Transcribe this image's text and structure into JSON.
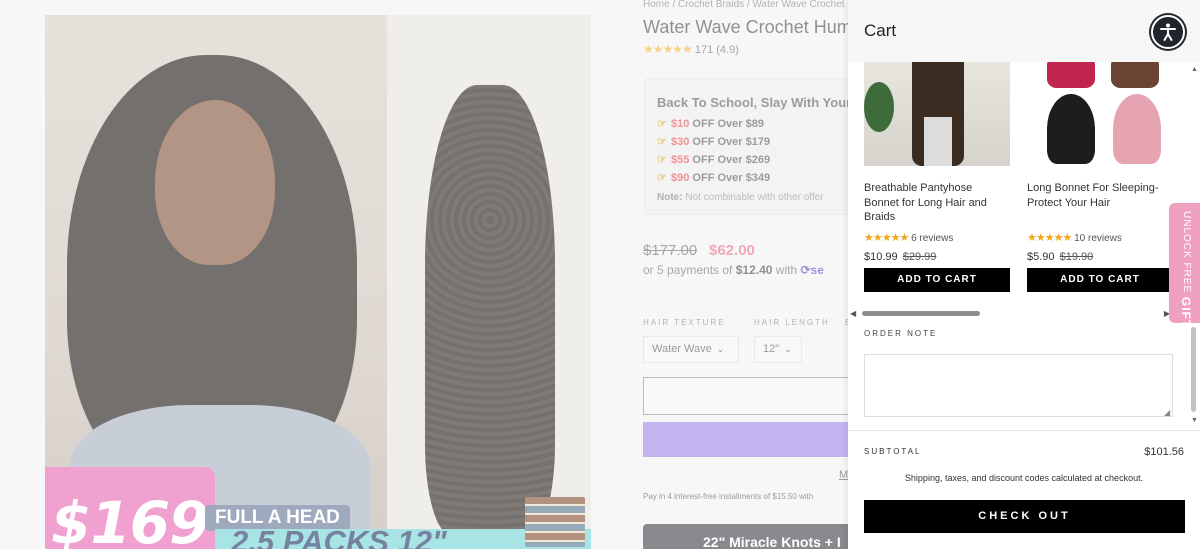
{
  "product_page": {
    "breadcrumb": "Home / Crochet Braids / Water Wave Crochet",
    "title": "Water Wave Crochet Hum",
    "rating": {
      "stars": "★★★★★",
      "text": "171 (4.9)"
    },
    "promo": {
      "title": "Back To School, Slay With Your",
      "offers": [
        {
          "amount": "$10",
          "text": "OFF Over $89"
        },
        {
          "amount": "$30",
          "text": "OFF Over $179"
        },
        {
          "amount": "$55",
          "text": "OFF Over $269"
        },
        {
          "amount": "$90",
          "text": "OFF Over $349"
        }
      ],
      "note_label": "Note:",
      "note_text": "Not combinable with other offer"
    },
    "price_compare": "$177.00",
    "price": "$62.00",
    "installments_prefix": "or 5 payments of",
    "installments_amount": "$12.40",
    "installments_with": "with",
    "installments_brand": "se",
    "options": {
      "texture_label": "HAIR TEXTURE",
      "texture_value": "Water Wave",
      "length_label": "HAIR LENGTH",
      "length_value": "12\"",
      "third_label": "E"
    },
    "more_link": "M",
    "pay4_text": "Pay in 4 interest-free installments of $15.50 with",
    "promo_banner": "22\" Miracle Knots + I",
    "image_banner": {
      "price": "$169",
      "line1": "FULL A HEAD",
      "line2": "2.5 PACKS 12\""
    }
  },
  "cart": {
    "title": "Cart",
    "accessibility_icon": "accessibility-icon",
    "recommendations": [
      {
        "name": "Breathable Pantyhose Bonnet for Long Hair and Braids",
        "stars": "★★★★★",
        "reviews": "6 reviews",
        "price": "$10.99",
        "compare_price": "$29.99",
        "button": "ADD TO CART"
      },
      {
        "name": "Long Bonnet For Sleeping-Protect Your Hair",
        "stars": "★★★★★",
        "reviews": "10 reviews",
        "price": "$5.90",
        "compare_price": "$19.90",
        "button": "ADD TO CART"
      }
    ],
    "order_note_label": "ORDER NOTE",
    "order_note_value": "",
    "subtotal_label": "SUBTOTAL",
    "subtotal_value": "$101.56",
    "shipping_note": "Shipping, taxes, and discount codes calculated at checkout.",
    "checkout_label": "CHECK OUT"
  },
  "gift_tab": {
    "line1": "UNLOCK FREE",
    "line2": "GIFT"
  },
  "colors": {
    "accent_price": "#e87a8e",
    "buy_button": "#a38be8",
    "gift_tab": "#f0a0bf",
    "checkout": "#000000",
    "review_stars": "#f2a51a"
  }
}
